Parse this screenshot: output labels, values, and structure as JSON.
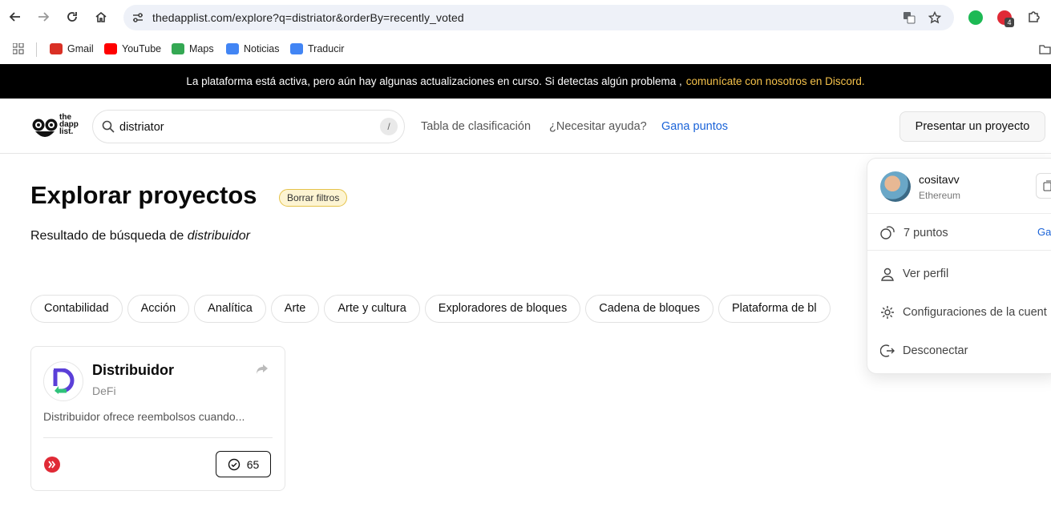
{
  "browser": {
    "url": "thedapplist.com/explore?q=distriator&orderBy=recently_voted",
    "extension_badge": "4",
    "bookmarks": [
      {
        "label": "Gmail",
        "color": "#d93025"
      },
      {
        "label": "YouTube",
        "color": "#ff0000"
      },
      {
        "label": "Maps",
        "color": "#34a853"
      },
      {
        "label": "Noticias",
        "color": "#4285f4"
      },
      {
        "label": "Traducir",
        "color": "#4285f4"
      }
    ]
  },
  "banner": {
    "text": "La plataforma está activa, pero aún hay algunas actualizaciones en curso. Si detectas algún problema ,",
    "link": "comunícate con nosotros en Discord."
  },
  "header": {
    "logo_text_1": "the",
    "logo_text_2": "dapp",
    "logo_text_3": "list.",
    "search_value": "distriator",
    "search_shortcut": "/",
    "nav_leaderboard": "Tabla de clasificación",
    "nav_help": "¿Necesitar ayuda?",
    "nav_points": "Gana puntos",
    "submit_button": "Presentar un proyecto"
  },
  "main": {
    "title": "Explorar proyectos",
    "clear_filters": "Borrar filtros",
    "subtitle_prefix": "Resultado de búsqueda de",
    "subtitle_query": "distribuidor",
    "categories": [
      "Contabilidad",
      "Acción",
      "Analítica",
      "Arte",
      "Arte y cultura",
      "Exploradores de bloques",
      "Cadena de bloques",
      "Plataforma de bl"
    ]
  },
  "project_card": {
    "name": "Distribuidor",
    "category": "DeFi",
    "description": "Distribuidor ofrece reembolsos cuando...",
    "votes": "65"
  },
  "user_menu": {
    "username": "cositavv",
    "network": "Ethereum",
    "points": "7 puntos",
    "earn": "Gan",
    "view_profile": "Ver perfil",
    "settings": "Configuraciones de la cuent",
    "disconnect": "Desconectar"
  }
}
